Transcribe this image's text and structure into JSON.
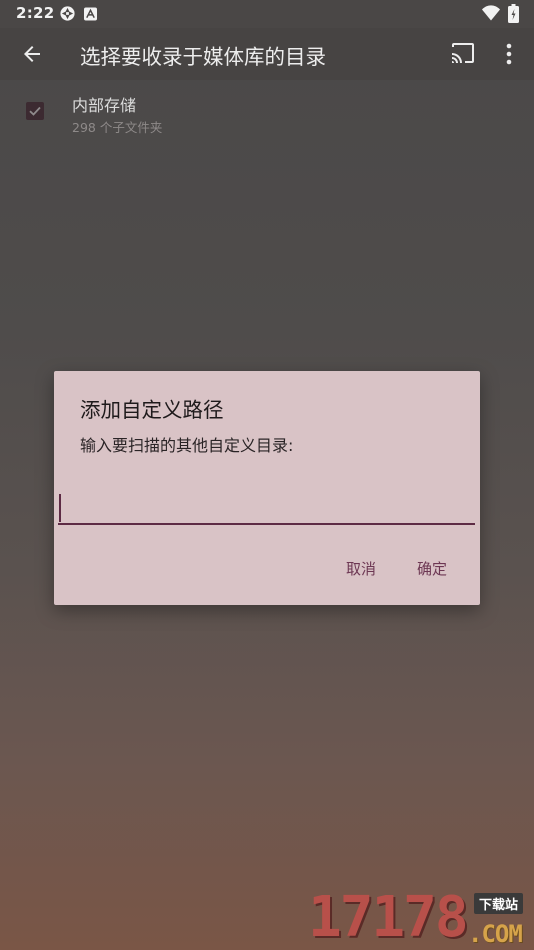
{
  "status_bar": {
    "time": "2:22"
  },
  "app_bar": {
    "title": "选择要收录于媒体库的目录"
  },
  "storage": {
    "name": "内部存储",
    "subfolder_count": "298 个子文件夹",
    "checked": true
  },
  "dialog": {
    "title": "添加自定义路径",
    "message": "输入要扫描的其他自定义目录:",
    "input_value": "",
    "cancel_label": "取消",
    "ok_label": "确定"
  },
  "watermark": {
    "digits": "17178",
    "tag": "下载站",
    "domain": ".COM"
  },
  "colors": {
    "accent": "#6d3753",
    "dialog_background": "#d9c3c6",
    "checkbox": "#3c2a31"
  },
  "icons": [
    "back-arrow-icon",
    "cast-icon",
    "overflow-menu-icon",
    "wifi-icon",
    "battery-icon",
    "checkmark-icon"
  ]
}
